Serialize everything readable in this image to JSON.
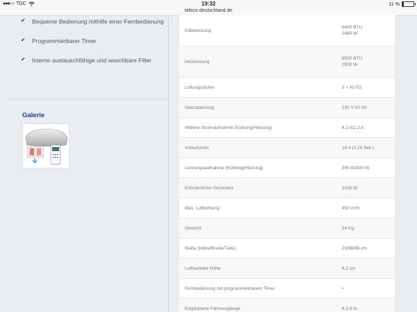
{
  "status_bar": {
    "carrier": "TDC",
    "time": "19:32",
    "url": "teleco-deutschland.de",
    "battery": "11 %",
    "battery_level": 0.11
  },
  "features": [
    "Bequeme Bedienung mithilfe einer Fernbedienung",
    "Programmierbarer Timer",
    "Interne austauschfähige und waschbare Filter"
  ],
  "gallery": {
    "title": "Galerie"
  },
  "specs": [
    {
      "label": "Kälteleistung",
      "value": "8400 BTU",
      "value2": "2460 W"
    },
    {
      "label": "Heizleistung",
      "value": "8500 BTU",
      "value2": "2500 W"
    },
    {
      "label": "Lüftungsstufen",
      "value": "3 + AUTO"
    },
    {
      "label": "Netzspannung",
      "value": "230 V 50 Hz"
    },
    {
      "label": "Mittlere Stromaufnahme (Kühlung/Heizung)",
      "value": "4,2 A/2,2 A"
    },
    {
      "label": "Anlaufstrom",
      "value": "18 A (0,15 Sek.)"
    },
    {
      "label": "Leistungsaufnahme (Kühlung/Heizung)",
      "value": "900 W/920 W"
    },
    {
      "label": "Erforderlicher Generator",
      "value": "2200 W"
    },
    {
      "label": "Max. Luftkühlung",
      "value": "450 m³/h"
    },
    {
      "label": "Gewicht",
      "value": "34 Kg"
    },
    {
      "label": "Maße (Höhe/Breite/Tiefe)",
      "value": "23/98/65 cm"
    },
    {
      "label": "Luftverteiler Höhe",
      "value": "6,2 cm"
    },
    {
      "label": "Fernbedienung mit programmierbarem Timer",
      "value": "•"
    },
    {
      "label": "Empfohlene Fahrzeuglänge",
      "value": "6,5-8 m"
    }
  ]
}
